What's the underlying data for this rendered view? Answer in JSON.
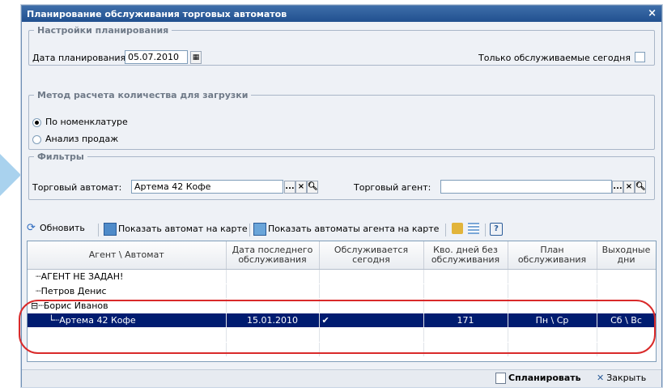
{
  "window": {
    "title": "Планирование обслуживания торговых автоматов",
    "close_glyph": "×"
  },
  "planning": {
    "legend": "Настройки планирования",
    "date_label": "Дата планирования:",
    "date_value": "05.07.2010",
    "only_today_label": "Только обслуживаемые сегодня"
  },
  "method": {
    "legend": "Метод расчета количества для загрузки",
    "options": [
      {
        "label": "По номенклатуре",
        "selected": true
      },
      {
        "label": "Анализ продаж",
        "selected": false
      }
    ]
  },
  "filters": {
    "legend": "Фильтры",
    "machine_label": "Торговый автомат:",
    "machine_value": "Артема 42 Кофе",
    "agent_label": "Торговый агент:",
    "agent_value": "",
    "ellipsis": "...",
    "clear": "×"
  },
  "toolbar": {
    "refresh": "Обновить",
    "show_machine": "Показать автомат на карте",
    "show_agent_machines": "Показать автоматы агента на карте",
    "help": "?"
  },
  "grid": {
    "columns": [
      "Агент \\ Автомат",
      "Дата последнего обслуживания",
      "Обслуживается сегодня",
      "Кво. дней без обслуживания",
      "План обслуживания",
      "Выходные дни"
    ],
    "rows": [
      {
        "tree": "┈АГЕНТ НЕ ЗАДАН!",
        "last": "",
        "today": "",
        "days": "",
        "plan": "",
        "off": ""
      },
      {
        "tree": "┈Петров Денис",
        "last": "",
        "today": "",
        "days": "",
        "plan": "",
        "off": ""
      },
      {
        "tree": "⊟┈Борис Иванов",
        "last": "",
        "today": "",
        "days": "",
        "plan": "",
        "off": ""
      },
      {
        "tree": "└┈Артема 42 Кофе",
        "last": "15.01.2010",
        "today": "✔",
        "days": "171",
        "plan": "Пн \\ Ср",
        "off": "Сб \\ Вс"
      }
    ]
  },
  "footer": {
    "plan_button": "Спланировать",
    "close_button": "Закрыть"
  }
}
